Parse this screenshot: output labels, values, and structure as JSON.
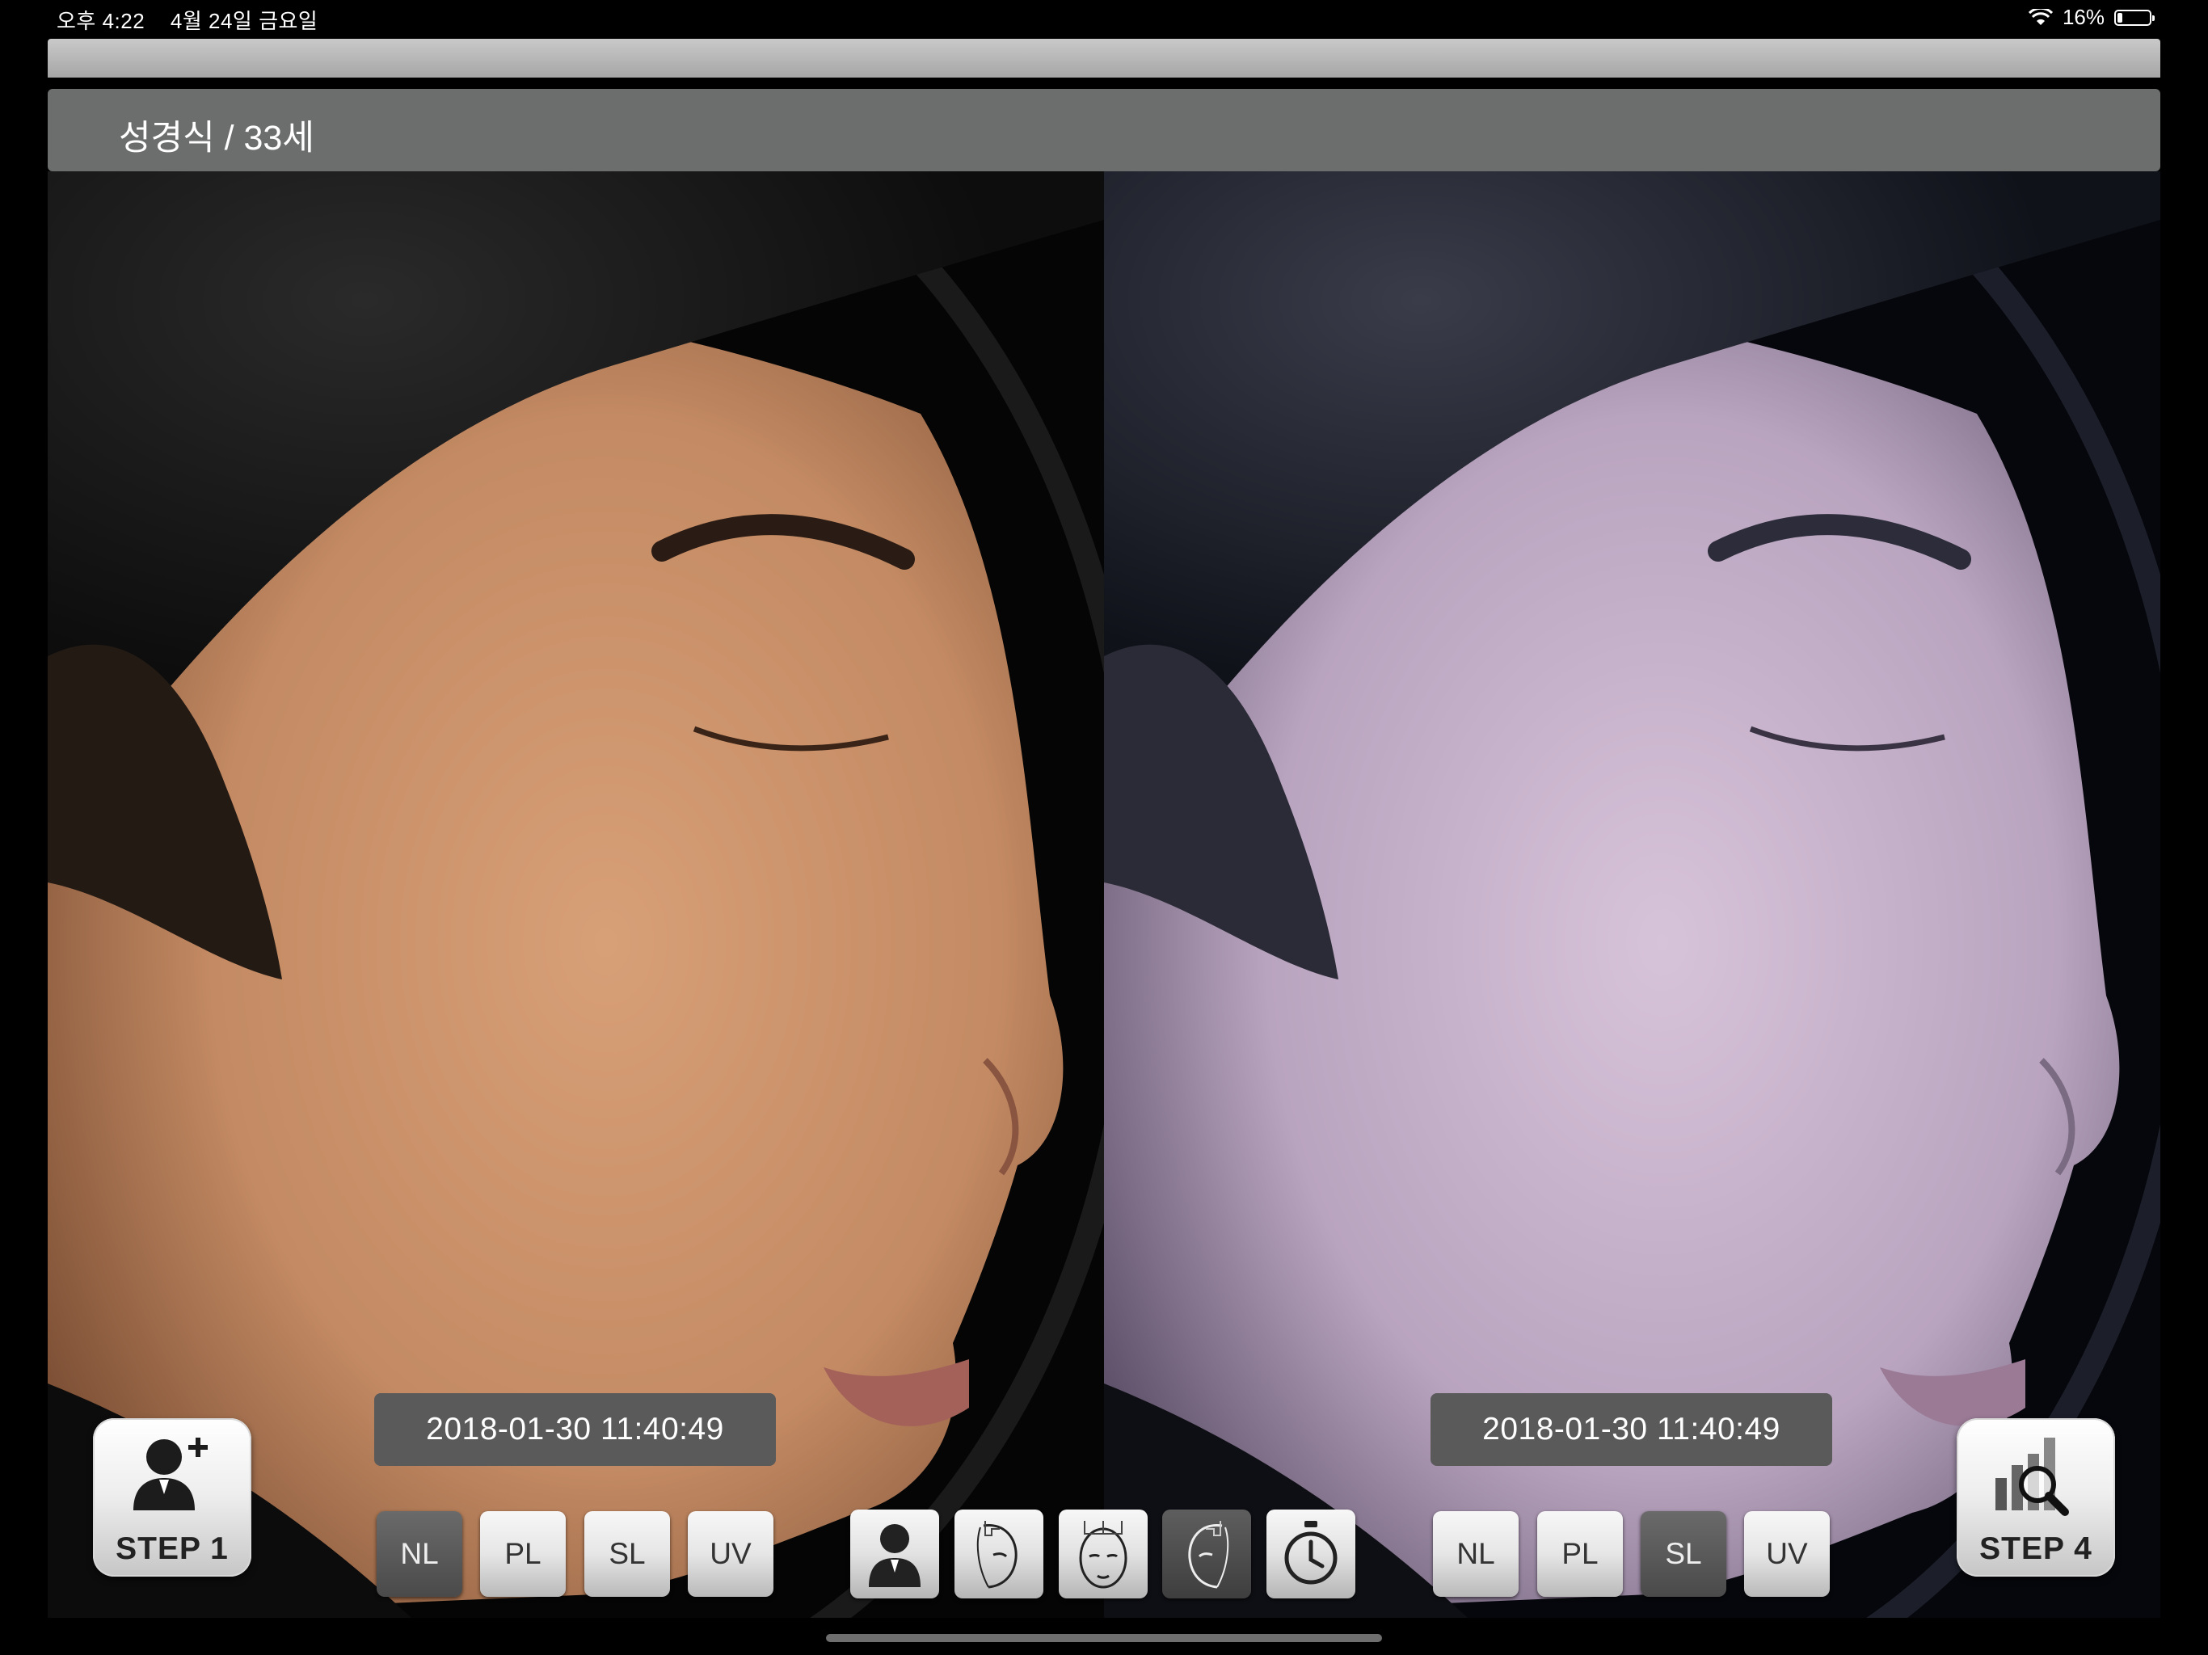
{
  "status_bar": {
    "time": "오후 4:22",
    "date": "4월 24일 금요일",
    "battery_percent": "16%",
    "battery_level": 0.16
  },
  "patient": {
    "label": "성경식 / 33세"
  },
  "left_panel": {
    "timestamp": "2018-01-30 11:40:49",
    "modes": [
      "NL",
      "PL",
      "SL",
      "UV"
    ],
    "active_mode": "NL"
  },
  "right_panel": {
    "timestamp": "2018-01-30 11:40:49",
    "modes": [
      "NL",
      "PL",
      "SL",
      "UV"
    ],
    "active_mode": "SL"
  },
  "step_buttons": {
    "left": "STEP 1",
    "right": "STEP 4"
  },
  "tools": [
    "person-icon",
    "face-right-grid-icon",
    "face-front-grid-icon",
    "face-left-grid-icon",
    "timer-icon"
  ],
  "active_tool": "face-left-grid-icon",
  "colors": {
    "name_bar": "#6c6d6d",
    "date_box": "#5a5a5a",
    "active_mode": "#555555"
  }
}
